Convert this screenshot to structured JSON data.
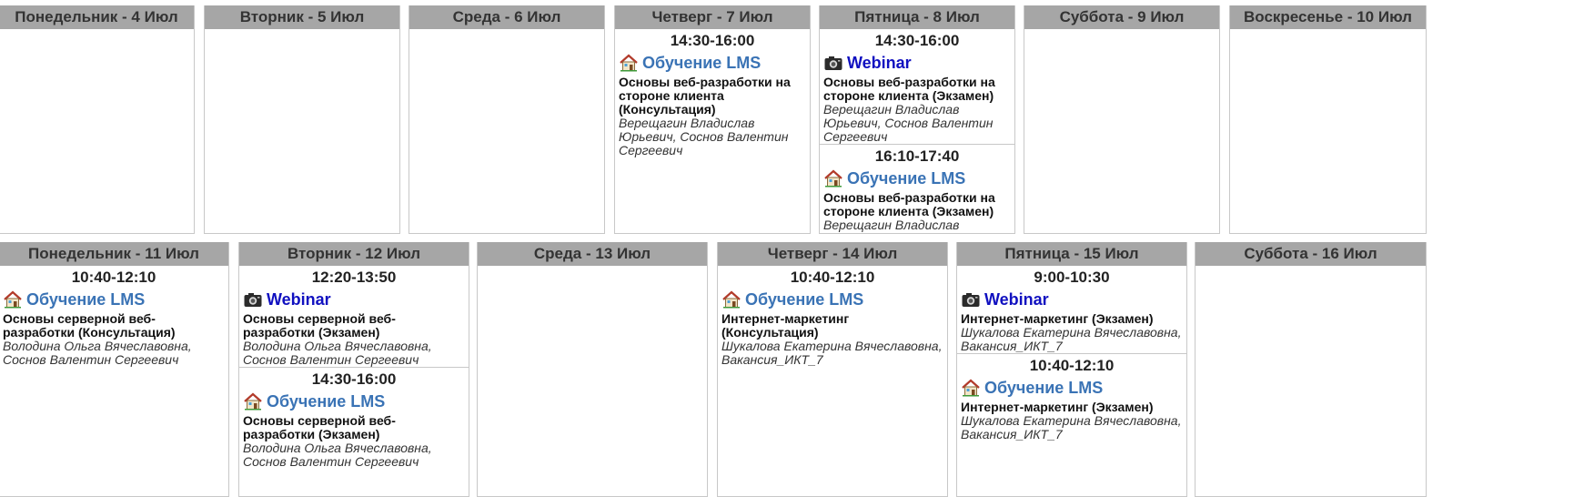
{
  "week1": [
    {
      "header": "Понедельник - 4 Июл",
      "lessons": []
    },
    {
      "header": "Вторник - 5 Июл",
      "lessons": []
    },
    {
      "header": "Среда - 6 Июл",
      "lessons": []
    },
    {
      "header": "Четверг - 7 Июл",
      "lessons": [
        {
          "time": "14:30-16:00",
          "kind": "lms",
          "link": "Обучение LMS",
          "subject": "Основы веб-разработки на стороне клиента (Консультация)",
          "teacher": "Верещагин Владислав Юрьевич, Соснов Валентин Сергеевич"
        }
      ]
    },
    {
      "header": "Пятница - 8 Июл",
      "lessons": [
        {
          "time": "14:30-16:00",
          "kind": "webinar",
          "link": "Webinar",
          "subject": "Основы веб-разработки на стороне клиента (Экзамен)",
          "teacher": "Верещагин Владислав Юрьевич, Соснов Валентин Сергеевич"
        },
        {
          "time": "16:10-17:40",
          "kind": "lms",
          "link": "Обучение LMS",
          "subject": "Основы веб-разработки на стороне клиента (Экзамен)",
          "teacher": "Верещагин Владислав Юрьевич, Соснов Валентин Сергеевич"
        }
      ]
    },
    {
      "header": "Суббота - 9 Июл",
      "lessons": []
    },
    {
      "header": "Воскресенье - 10 Июл",
      "lessons": []
    }
  ],
  "week2": [
    {
      "header": "Понедельник - 11 Июл",
      "lessons": [
        {
          "time": "10:40-12:10",
          "kind": "lms",
          "link": "Обучение LMS",
          "subject": "Основы серверной веб-разработки (Консультация)",
          "teacher": "Володина Ольга Вячеславовна, Соснов Валентин Сергеевич"
        }
      ]
    },
    {
      "header": "Вторник - 12 Июл",
      "lessons": [
        {
          "time": "12:20-13:50",
          "kind": "webinar",
          "link": "Webinar",
          "subject": "Основы серверной веб-разработки (Экзамен)",
          "teacher": "Володина Ольга Вячеславовна, Соснов Валентин Сергеевич"
        },
        {
          "time": "14:30-16:00",
          "kind": "lms",
          "link": "Обучение LMS",
          "subject": "Основы серверной веб-разработки (Экзамен)",
          "teacher": "Володина Ольга Вячеславовна, Соснов Валентин Сергеевич"
        }
      ]
    },
    {
      "header": "Среда - 13 Июл",
      "lessons": []
    },
    {
      "header": "Четверг - 14 Июл",
      "lessons": [
        {
          "time": "10:40-12:10",
          "kind": "lms",
          "link": "Обучение LMS",
          "subject": "Интернет-маркетинг (Консультация)",
          "teacher": "Шукалова Екатерина Вячеславовна, Вакансия_ИКТ_7"
        }
      ]
    },
    {
      "header": "Пятница - 15 Июл",
      "lessons": [
        {
          "time": "9:00-10:30",
          "kind": "webinar",
          "link": "Webinar",
          "subject": "Интернет-маркетинг (Экзамен)",
          "teacher": "Шукалова Екатерина Вячеславовна, Вакансия_ИКТ_7"
        },
        {
          "time": "10:40-12:10",
          "kind": "lms",
          "link": "Обучение LMS",
          "subject": "Интернет-маркетинг (Экзамен)",
          "teacher": "Шукалова Екатерина Вячеславовна, Вакансия_ИКТ_7"
        }
      ]
    },
    {
      "header": "Суббота - 16 Июл",
      "lessons": []
    }
  ],
  "colors": {
    "header_bg": "#a6a6a6",
    "lms_link": "#3a73b5",
    "webinar_link": "#1010c0",
    "border": "#c8c8c8"
  },
  "icons": {
    "lms": "house-icon",
    "webinar": "camera-icon"
  }
}
